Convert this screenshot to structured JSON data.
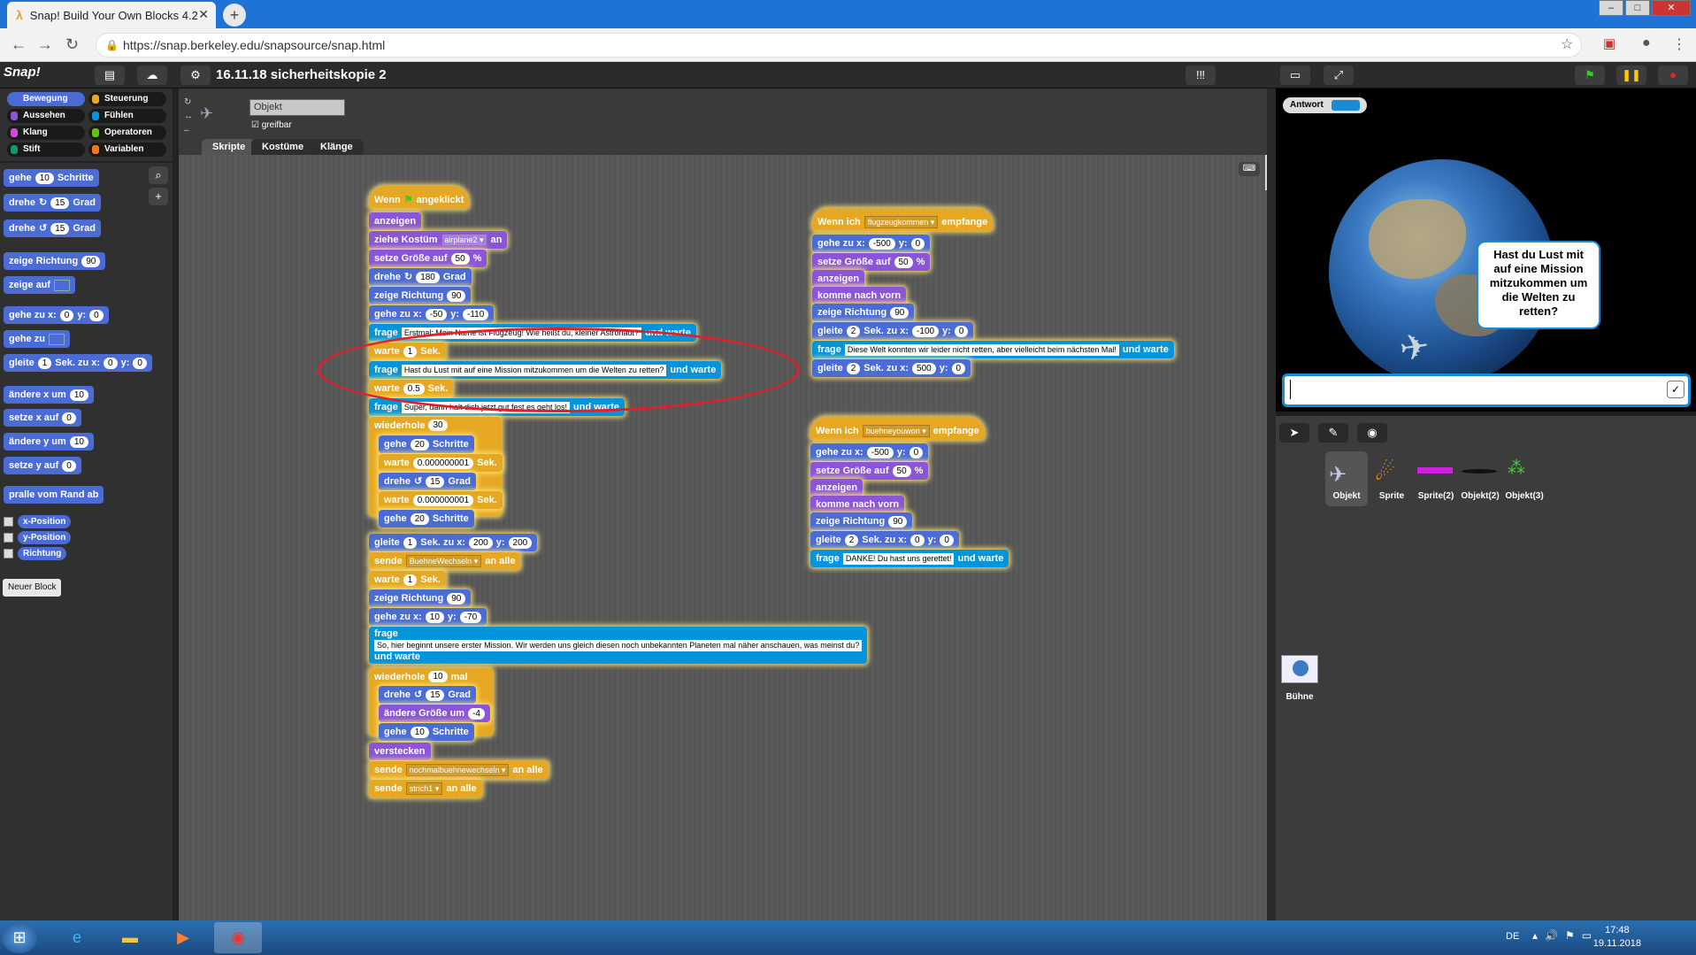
{
  "browser": {
    "tab_title": "Snap! Build Your Own Blocks 4.2",
    "url": "https://snap.berkeley.edu/snapsource/snap.html"
  },
  "snap": {
    "logo": "Snap!",
    "project_title": "16.11.18 sicherheitskopie 2",
    "categories": [
      "Bewegung",
      "Aussehen",
      "Klang",
      "Stift",
      "Steuerung",
      "Fühlen",
      "Operatoren",
      "Variablen"
    ],
    "category_colors": {
      "Bewegung": "#4a6cd4",
      "Aussehen": "#8a55d7",
      "Klang": "#cf4ad9",
      "Stift": "#0e9a6c",
      "Steuerung": "#e6a822",
      "Fühlen": "#0494dc",
      "Operatoren": "#62c213",
      "Variablen": "#f3761d"
    },
    "sprite_name": "Objekt",
    "draggable_label": "greifbar",
    "tabs": [
      "Skripte",
      "Kostüme",
      "Klänge"
    ],
    "palette": {
      "move": {
        "a": "gehe",
        "b": "10",
        "c": "Schritte"
      },
      "turn_right": {
        "a": "drehe",
        "b": "15",
        "c": "Grad"
      },
      "turn_left": {
        "a": "drehe",
        "b": "15",
        "c": "Grad"
      },
      "point_dir": {
        "a": "zeige Richtung",
        "b": "90"
      },
      "point_to": {
        "a": "zeige auf"
      },
      "goto_xy": {
        "a": "gehe zu x:",
        "b": "0",
        "c": "y:",
        "d": "0"
      },
      "goto": {
        "a": "gehe zu"
      },
      "glide": {
        "a": "gleite",
        "b": "1",
        "c": "Sek. zu x:",
        "d": "0",
        "e": "y:",
        "f": "0"
      },
      "change_x": {
        "a": "ändere x um",
        "b": "10"
      },
      "set_x": {
        "a": "setze x auf",
        "b": "0"
      },
      "change_y": {
        "a": "ändere y um",
        "b": "10"
      },
      "set_y": {
        "a": "setze y auf",
        "b": "0"
      },
      "bounce": "pralle vom Rand ab",
      "reporters": [
        "x-Position",
        "y-Position",
        "Richtung"
      ],
      "new_block": "Neuer Block"
    }
  },
  "script1": {
    "hat": {
      "a": "Wenn",
      "b": "angeklickt"
    },
    "b1": "anzeigen",
    "b2": {
      "a": "ziehe Kostüm",
      "b": "airplane2",
      "c": "an"
    },
    "b3": {
      "a": "setze Größe auf",
      "b": "50",
      "c": "%"
    },
    "b4": {
      "a": "drehe",
      "b": "180",
      "c": "Grad"
    },
    "b5": {
      "a": "zeige Richtung",
      "b": "90"
    },
    "b6": {
      "a": "gehe zu x:",
      "b": "-50",
      "c": "y:",
      "d": "-110"
    },
    "b7": {
      "a": "frage",
      "b": "Erstmal: Mein Name ist Flugzeug! Wie heißt du, kleiner Astronaut?",
      "c": "und warte"
    },
    "b8": {
      "a": "warte",
      "b": "1",
      "c": "Sek."
    },
    "b9": {
      "a": "frage",
      "b": "Hast du Lust mit auf eine Mission mitzukommen um die Welten zu retten?",
      "c": "und warte"
    },
    "b10": {
      "a": "warte",
      "b": "0.5",
      "c": "Sek."
    },
    "b11": {
      "a": "frage",
      "b": "Super, dann halt dich jetzt gut fest es geht los!",
      "c": "und warte"
    },
    "b12": {
      "a": "wiederhole",
      "b": "30"
    },
    "b13": {
      "a": "gehe",
      "b": "20",
      "c": "Schritte"
    },
    "b14": {
      "a": "warte",
      "b": "0.000000001",
      "c": "Sek."
    },
    "b15": {
      "a": "drehe",
      "b": "15",
      "c": "Grad"
    },
    "b16": {
      "a": "warte",
      "b": "0.000000001",
      "c": "Sek."
    },
    "b17": {
      "a": "gehe",
      "b": "20",
      "c": "Schritte"
    },
    "b18": {
      "a": "gleite",
      "b": "1",
      "c": "Sek. zu x:",
      "d": "200",
      "e": "y:",
      "f": "200"
    },
    "b19": {
      "a": "sende",
      "b": "BuehneWechseln",
      "c": "an alle"
    },
    "b20": {
      "a": "warte",
      "b": "1",
      "c": "Sek."
    },
    "b21": {
      "a": "zeige Richtung",
      "b": "90"
    },
    "b22": {
      "a": "gehe zu x:",
      "b": "10",
      "c": "y:",
      "d": "-70"
    },
    "b23": {
      "a": "frage",
      "b": "So, hier beginnt unsere erster Mission. Wir werden uns gleich diesen noch unbekannten Planeten mal näher anschauen, was meinst du?",
      "c": "und warte"
    },
    "b24": {
      "a": "wiederhole",
      "b": "10",
      "c": "mal"
    },
    "b25": {
      "a": "drehe",
      "b": "15",
      "c": "Grad"
    },
    "b26": {
      "a": "ändere Größe um",
      "b": "-4"
    },
    "b27": {
      "a": "gehe",
      "b": "10",
      "c": "Schritte"
    },
    "b28": "verstecken",
    "b29": {
      "a": "sende",
      "b": "nochmalbuehnewechseln",
      "c": "an alle"
    },
    "b30": {
      "a": "sende",
      "b": "strich1",
      "c": "an alle"
    }
  },
  "script2": {
    "hat": {
      "a": "Wenn ich",
      "b": "flugzeugkommen",
      "c": "empfange"
    },
    "b1": {
      "a": "gehe zu x:",
      "b": "-500",
      "c": "y:",
      "d": "0"
    },
    "b2": {
      "a": "setze Größe auf",
      "b": "50",
      "c": "%"
    },
    "b3": "anzeigen",
    "b4": "komme nach vorn",
    "b5": {
      "a": "zeige Richtung",
      "b": "90"
    },
    "b6": {
      "a": "gleite",
      "b": "2",
      "c": "Sek. zu x:",
      "d": "-100",
      "e": "y:",
      "f": "0"
    },
    "b7": {
      "a": "frage",
      "b": "Diese Welt konnten wir leider nicht retten, aber vielleicht beim nächsten Mal!",
      "c": "und warte"
    },
    "b8": {
      "a": "gleite",
      "b": "2",
      "c": "Sek. zu x:",
      "d": "500",
      "e": "y:",
      "f": "0"
    }
  },
  "script3": {
    "hat": {
      "a": "Wenn ich",
      "b": "buehneyouwon",
      "c": "empfange"
    },
    "b1": {
      "a": "gehe zu x:",
      "b": "-500",
      "c": "y:",
      "d": "0"
    },
    "b2": {
      "a": "setze Größe auf",
      "b": "50",
      "c": "%"
    },
    "b3": "anzeigen",
    "b4": "komme nach vorn",
    "b5": {
      "a": "zeige Richtung",
      "b": "90"
    },
    "b6": {
      "a": "gleite",
      "b": "2",
      "c": "Sek. zu x:",
      "d": "0",
      "e": "y:",
      "f": "0"
    },
    "b7": {
      "a": "frage",
      "b": "DANKE! Du hast uns gerettet!",
      "c": "und warte"
    }
  },
  "stage": {
    "answer_label": "Antwort",
    "bubble": "Hast du Lust mit auf eine Mission mitzukommen um die Welten zu retten?",
    "ask_check": "✓"
  },
  "corral": {
    "sprites": [
      "Objekt",
      "Sprite",
      "Sprite(2)",
      "Objekt(2)",
      "Objekt(3)"
    ],
    "stage_label": "Bühne"
  },
  "taskbar": {
    "lang": "DE",
    "time": "17:48",
    "date": "19.11.2018"
  }
}
